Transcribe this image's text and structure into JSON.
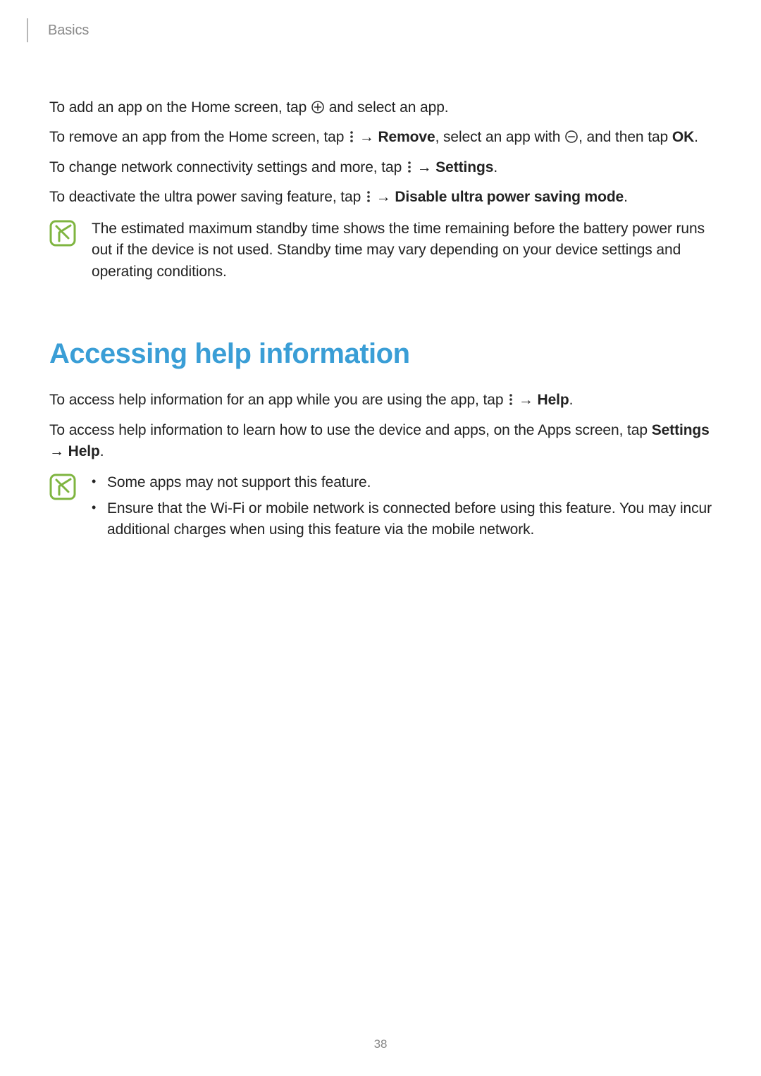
{
  "header": {
    "breadcrumb": "Basics"
  },
  "paragraphs": {
    "p1_a": "To add an app on the Home screen, tap ",
    "p1_b": " and select an app.",
    "p2_a": "To remove an app from the Home screen, tap ",
    "arrow": " → ",
    "p2_remove": "Remove",
    "p2_b": ", select an app with ",
    "p2_c": ", and then tap ",
    "p2_ok": "OK",
    "p2_d": ".",
    "p3_a": "To change network connectivity settings and more, tap ",
    "p3_settings": "Settings",
    "p3_b": ".",
    "p4_a": "To deactivate the ultra power saving feature, tap ",
    "p4_disable": "Disable ultra power saving mode",
    "p4_b": ".",
    "note1": "The estimated maximum standby time shows the time remaining before the battery power runs out if the device is not used. Standby time may vary depending on your device settings and operating conditions.",
    "h2": "Accessing help information",
    "p5_a": "To access help information for an app while you are using the app, tap ",
    "p5_help": "Help",
    "p5_b": ".",
    "p6_a": "To access help information to learn how to use the device and apps, on the Apps screen, tap ",
    "p6_settings": "Settings",
    "p6_arrow": " → ",
    "p6_help": "Help",
    "p6_b": ".",
    "note2_li1": "Some apps may not support this feature.",
    "note2_li2": "Ensure that the Wi-Fi or mobile network is connected before using this feature. You may incur additional charges when using this feature via the mobile network."
  },
  "page_number": "38",
  "colors": {
    "accent": "#3a9ed6",
    "note_green": "#7FB540"
  }
}
